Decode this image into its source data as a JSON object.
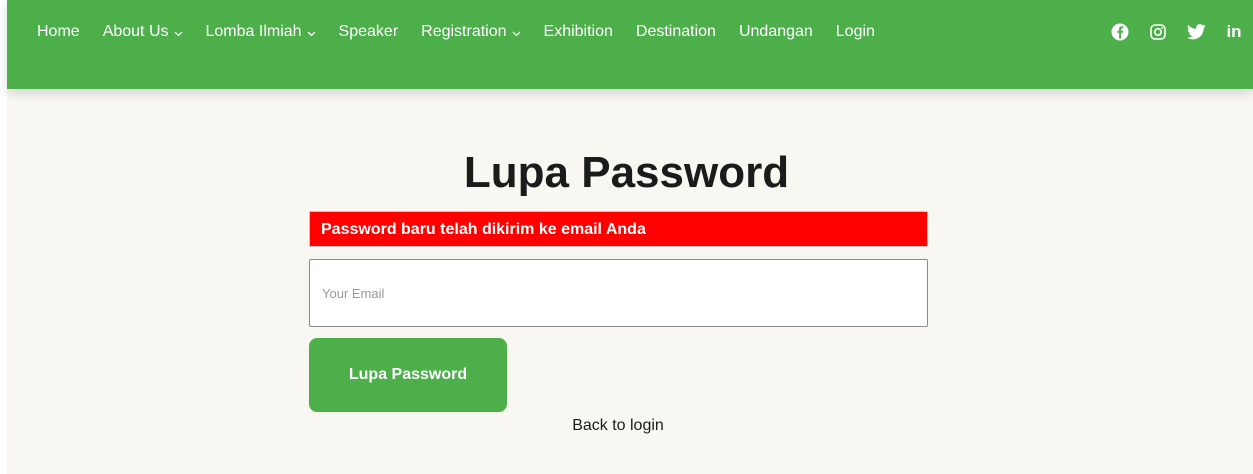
{
  "nav": {
    "items": [
      {
        "label": "Home",
        "dropdown": false
      },
      {
        "label": "About Us",
        "dropdown": true
      },
      {
        "label": "Lomba Ilmiah",
        "dropdown": true
      },
      {
        "label": "Speaker",
        "dropdown": false
      },
      {
        "label": "Registration",
        "dropdown": true
      },
      {
        "label": "Exhibition",
        "dropdown": false
      },
      {
        "label": "Destination",
        "dropdown": false
      },
      {
        "label": "Undangan",
        "dropdown": false
      },
      {
        "label": "Login",
        "dropdown": false
      }
    ],
    "social": [
      "facebook-icon",
      "instagram-icon",
      "twitter-icon",
      "linkedin-icon"
    ],
    "linkedin_text": "in"
  },
  "main": {
    "title": "Lupa Password",
    "alert": "Password baru telah dikirim ke email Anda",
    "email_placeholder": "Your Email",
    "email_value": "",
    "submit_label": "Lupa Password",
    "back_link": "Back to login"
  },
  "colors": {
    "brand_green": "#4caf4a",
    "alert_red": "#ff0000",
    "page_background": "#f8f7f2"
  }
}
